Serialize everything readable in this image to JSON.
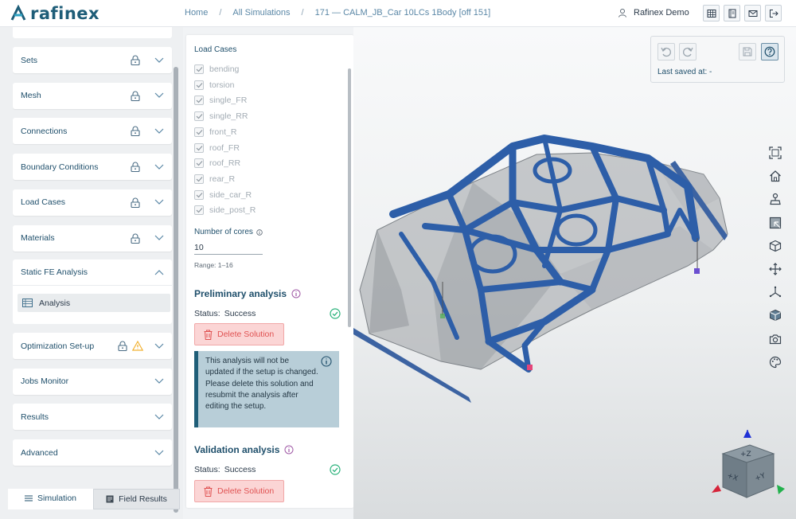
{
  "app": {
    "logo": "rafinex"
  },
  "breadcrumb": {
    "home": "Home",
    "all": "All Simulations",
    "current": "171 — CALM_JB_Car 10LCs 1Body [off 151]",
    "sep": "/"
  },
  "user": {
    "name": "Rafinex Demo"
  },
  "top_icons": [
    "table-icon",
    "notebook-icon",
    "mail-icon",
    "logout-icon"
  ],
  "nav": {
    "items": [
      {
        "label": "Sets",
        "locked": true,
        "warning": false
      },
      {
        "label": "Mesh",
        "locked": true,
        "warning": false
      },
      {
        "label": "Connections",
        "locked": true,
        "warning": false
      },
      {
        "label": "Boundary Conditions",
        "locked": true,
        "warning": false
      },
      {
        "label": "Load Cases",
        "locked": true,
        "warning": false
      },
      {
        "label": "Materials",
        "locked": true,
        "warning": false
      }
    ],
    "expanded": {
      "label": "Static FE Analysis",
      "child": "Analysis"
    },
    "items_after": [
      {
        "label": "Optimization Set-up",
        "locked": true,
        "warning": true
      },
      {
        "label": "Jobs Monitor",
        "locked": false,
        "warning": false
      },
      {
        "label": "Results",
        "locked": false,
        "warning": false
      },
      {
        "label": "Advanced",
        "locked": false,
        "warning": false
      }
    ],
    "tabs": {
      "simulation": "Simulation",
      "field_results": "Field Results"
    }
  },
  "panel": {
    "load_cases_title": "Load Cases",
    "load_cases": [
      "bending",
      "torsion",
      "single_FR",
      "single_RR",
      "front_R",
      "roof_FR",
      "roof_RR",
      "rear_R",
      "side_car_R",
      "side_post_R"
    ],
    "cores_label": "Number of cores",
    "cores_value": "10",
    "cores_range": "Range: 1–16",
    "preliminary": {
      "title": "Preliminary analysis",
      "status_key": "Status:",
      "status_value": "Success",
      "delete_label": "Delete Solution"
    },
    "info_message": "This analysis will not be updated if the setup is changed. Please delete this solution and resubmit the analysis after editing the setup.",
    "validation": {
      "title": "Validation analysis",
      "status_key": "Status:",
      "status_value": "Success",
      "delete_label": "Delete Solution"
    }
  },
  "viewport": {
    "last_saved": "Last saved at: -",
    "tools": [
      "fit-view-icon",
      "home-view-icon",
      "fixation-icon",
      "selection-icon",
      "cube-view-icon",
      "move-icon",
      "axes-icon",
      "material-cube-icon",
      "camera-icon",
      "palette-icon"
    ],
    "cube_labels": {
      "z": "+Z",
      "x": "+X",
      "y": "+Y"
    }
  },
  "colors": {
    "accent": "#1f4f6b",
    "success": "#2ab27b",
    "danger": "#e05252",
    "warning": "#f2b233",
    "info_help": "#a05aa6",
    "structure_blue": "#2d5ea8"
  }
}
